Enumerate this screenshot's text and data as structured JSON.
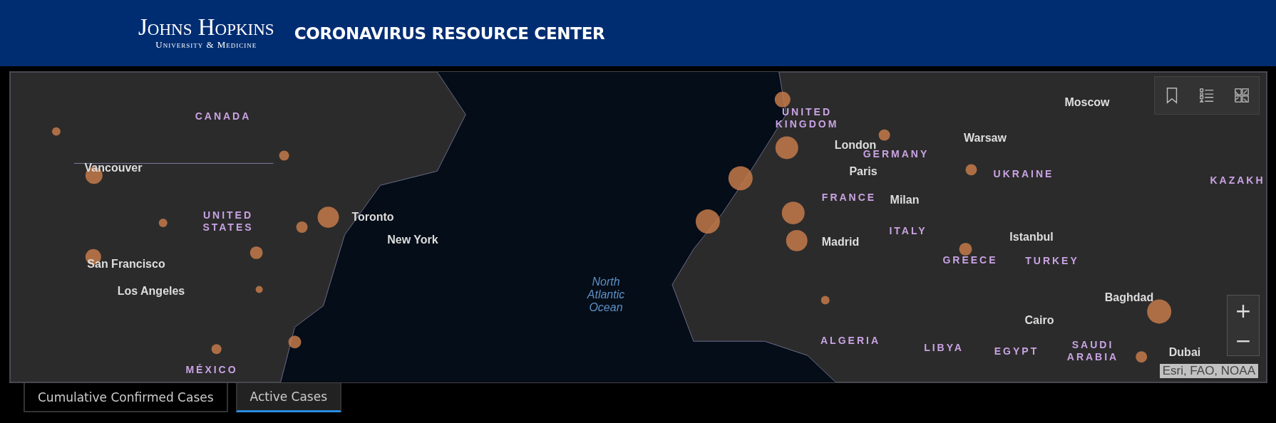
{
  "header": {
    "logo": {
      "name": "Johns Hopkins",
      "subtitle": "University & Medicine"
    },
    "title": "CORONAVIRUS RESOURCE CENTER"
  },
  "map": {
    "labels": [
      {
        "kind": "country",
        "text": "CANADA"
      },
      {
        "kind": "country",
        "text": "UNITED STATES"
      },
      {
        "kind": "country",
        "text": "MÉXICO"
      },
      {
        "kind": "country",
        "text": "UNITED KINGDOM"
      },
      {
        "kind": "country",
        "text": "GERMANY"
      },
      {
        "kind": "country",
        "text": "FRANCE"
      },
      {
        "kind": "country",
        "text": "UKRAINE"
      },
      {
        "kind": "country",
        "text": "KAZAKH"
      },
      {
        "kind": "country",
        "text": "ITALY"
      },
      {
        "kind": "country",
        "text": "GREECE"
      },
      {
        "kind": "country",
        "text": "TURKEY"
      },
      {
        "kind": "country",
        "text": "ALGERIA"
      },
      {
        "kind": "country",
        "text": "LIBYA"
      },
      {
        "kind": "country",
        "text": "EGYPT"
      },
      {
        "kind": "country",
        "text": "SAUDI ARABIA"
      },
      {
        "kind": "city",
        "text": "Vancouver"
      },
      {
        "kind": "city",
        "text": "Toronto"
      },
      {
        "kind": "city",
        "text": "New York"
      },
      {
        "kind": "city",
        "text": "San Francisco"
      },
      {
        "kind": "city",
        "text": "Los Angeles"
      },
      {
        "kind": "city",
        "text": "London"
      },
      {
        "kind": "city",
        "text": "Paris"
      },
      {
        "kind": "city",
        "text": "Milan"
      },
      {
        "kind": "city",
        "text": "Madrid"
      },
      {
        "kind": "city",
        "text": "Warsaw"
      },
      {
        "kind": "city",
        "text": "Moscow"
      },
      {
        "kind": "city",
        "text": "Istanbul"
      },
      {
        "kind": "city",
        "text": "Cairo"
      },
      {
        "kind": "city",
        "text": "Baghdad"
      },
      {
        "kind": "city",
        "text": "Dubai"
      },
      {
        "kind": "ocean",
        "text": "North Atlantic Ocean"
      }
    ],
    "zoom": [
      "+",
      "−"
    ],
    "attribution": "Esri, FAO, NOAA"
  },
  "tabs": [
    {
      "label": "Cumulative Confirmed Cases",
      "selected": false
    },
    {
      "label": "Active Cases",
      "selected": true
    }
  ]
}
